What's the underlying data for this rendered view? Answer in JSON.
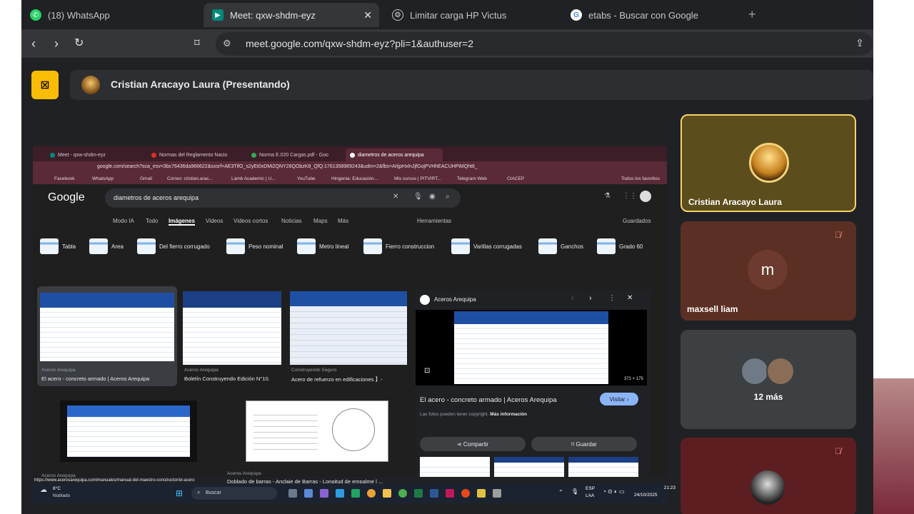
{
  "browser": {
    "tabs": [
      {
        "label": "(18) WhatsApp",
        "icon": "whatsapp-icon"
      },
      {
        "label": "Meet: qxw-shdm-eyz",
        "icon": "meet-icon",
        "active": true
      },
      {
        "label": "Limitar carga HP Victus",
        "icon": "openai-icon"
      },
      {
        "label": "etabs - Buscar con Google",
        "icon": "google-icon"
      }
    ],
    "url": "meet.google.com/qxw-shdm-eyz?pli=1&authuser=2"
  },
  "meet": {
    "presenter_label": "Cristian Aracayo Laura (Presentando)",
    "participants": [
      {
        "name": "Cristian Aracayo Laura"
      },
      {
        "name": "maxsell liam",
        "initial": "m"
      },
      {
        "name": "12 más"
      },
      {
        "name": ""
      }
    ]
  },
  "shared_screen": {
    "tabs": [
      "Meet - qxw-shdm-eyz",
      "Normas del Reglamento Nacio",
      "Norma E.020 Cargas.pdf - Goo",
      "diametros de aceros arequipa"
    ],
    "url": "google.com/search?sca_esv=3bc76436da966622&sxsrf=AE3TifO_s2yEt0xDMi2QNY26QObzK8_QfQ:1761358989243&udm=2&fbs=AIIjpHxlnJjfGojPVHhEACUHPiMQht6_",
    "bookmarks": [
      "Facebook",
      "WhatsApp",
      "Gmail",
      "Correo: cristian.arac...",
      "Lamb Academic | U...",
      "YouTube",
      "Hingenia: Educación...",
      "Mis cursos | PITVIRT...",
      "Telegram Web",
      "CIACEP",
      "Todos los favoritos"
    ],
    "google": {
      "logo": "Google",
      "query": "diametros de aceros arequipa",
      "nav": [
        "Modo IA",
        "Todo",
        "Imágenes",
        "Videos",
        "Videos cortos",
        "Noticias",
        "Maps",
        "Más",
        "Herramientas",
        "Guardados"
      ],
      "chips": [
        "Tabla",
        "Area",
        "Del fierro corrugado",
        "Peso nominal",
        "Metro lineal",
        "Fierro construccion",
        "Varillas corrugadas",
        "Ganchos",
        "Grado 60"
      ],
      "results": [
        {
          "source": "Aceros Arequipa",
          "title": "El acero - concreto armado | Aceros Arequipa"
        },
        {
          "source": "Aceros Arequipa",
          "title": "Boletín Construyendo Edición N°10."
        },
        {
          "source": "Construyendo Seguro",
          "title": "Acero de refuerzo en edificaciones 】-"
        },
        {
          "source": "Aceros Arequipa",
          "title": ""
        },
        {
          "source": "Aceros Arequipa",
          "title": "Doblado de barras - Anclaje de Barras - Longitud de empalme | ..."
        }
      ],
      "preview": {
        "source": "Aceros Arequipa",
        "title": "El acero - concreto armado | Aceros Arequipa",
        "size": "371 × 175",
        "visit": "Visitar",
        "note": "Las fotos pueden tener copyright.",
        "more_info": "Más información",
        "share": "Compartir",
        "save": "Guardar"
      },
      "status_url": "https://www.acerosarequipa.com/manuales/manual-del-maestro-constructor/el-acero"
    },
    "taskbar": {
      "weather_temp": "8°C",
      "weather_desc": "Nublado",
      "search": "Buscar",
      "lang": "ESP",
      "lang2": "LAA",
      "time": "21:23",
      "date": "24/10/2025"
    }
  }
}
